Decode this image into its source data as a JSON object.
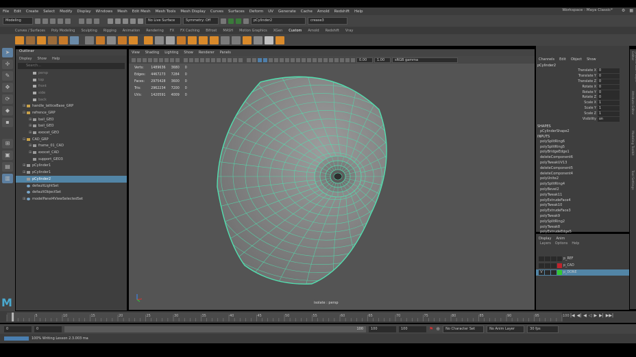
{
  "menubar": [
    "File",
    "Edit",
    "Create",
    "Select",
    "Modify",
    "Display",
    "Windows",
    "Mesh",
    "Edit Mesh",
    "Mesh Tools",
    "Mesh Display",
    "Curves",
    "Surfaces",
    "Deform",
    "UV",
    "Generate",
    "Cache",
    "Arnold",
    "Redshift",
    "Help"
  ],
  "workspace": {
    "label": "Workspace :",
    "value": "Maya Classic*"
  },
  "statusline": {
    "mode": "Modeling",
    "live_surface": "No Live Surface",
    "symmetry": "Symmetry: Off",
    "object_field": "pCylinder2",
    "search_field": "crease3"
  },
  "shelf_tabs": [
    "Curves / Surfaces",
    "Poly Modeling",
    "Sculpting",
    "Rigging",
    "Animation",
    "Rendering",
    "FX",
    "FX Caching",
    "Bifrost",
    "MASH",
    "Motion Graphics",
    "XGen",
    "Custom",
    "Arnold",
    "Redshift",
    "Vray"
  ],
  "shelf_active": "Custom",
  "outliner": {
    "title": "Outliner",
    "menu": [
      "Display",
      "Show",
      "Help"
    ],
    "search_placeholder": "Search...",
    "rows": [
      {
        "label": "persp",
        "indent": 1,
        "type": "cam",
        "dim": true
      },
      {
        "label": "top",
        "indent": 1,
        "type": "cam",
        "dim": true
      },
      {
        "label": "front",
        "indent": 1,
        "type": "cam",
        "dim": true
      },
      {
        "label": "side",
        "indent": 1,
        "type": "cam",
        "dim": true
      },
      {
        "label": "back",
        "indent": 1,
        "type": "cam",
        "dim": true
      },
      {
        "label": "handle_latticeBase_GRP",
        "indent": 0,
        "type": "grp",
        "expand": "+"
      },
      {
        "label": "refrence_GRP",
        "indent": 0,
        "type": "grp",
        "expand": "-"
      },
      {
        "label": "bail_GEO",
        "indent": 1,
        "type": "mesh",
        "expand": "+"
      },
      {
        "label": "bail_GEO",
        "indent": 1,
        "type": "mesh",
        "expand": "+"
      },
      {
        "label": "exocet_GEO",
        "indent": 1,
        "type": "mesh",
        "expand": "+"
      },
      {
        "label": "CAD_GRP",
        "indent": 0,
        "type": "grp",
        "expand": "-"
      },
      {
        "label": "frame_01_CAD",
        "indent": 1,
        "type": "mesh",
        "expand": "+"
      },
      {
        "label": "exocet_CAD",
        "indent": 1,
        "type": "mesh",
        "expand": "+"
      },
      {
        "label": "support_GEO3",
        "indent": 1,
        "type": "mesh"
      },
      {
        "label": "pCylinder1",
        "indent": 0,
        "type": "mesh",
        "expand": "+"
      },
      {
        "label": "pCylinder1",
        "indent": 0,
        "type": "mesh",
        "expand": "+"
      },
      {
        "label": "pCylinder2",
        "indent": 0,
        "type": "mesh",
        "sel": true
      },
      {
        "label": "defaultLightSet",
        "indent": 0,
        "type": "set"
      },
      {
        "label": "defaultObjectSet",
        "indent": 0,
        "type": "set"
      },
      {
        "label": "modelPanel4ViewSelectedSet",
        "indent": 0,
        "type": "set",
        "expand": "+"
      }
    ]
  },
  "viewport": {
    "menu": [
      "View",
      "Shading",
      "Lighting",
      "Show",
      "Renderer",
      "Panels"
    ],
    "exposure": "0.00",
    "gamma": "1.00",
    "colorspace": "sRGB gamma",
    "camera_label": "isolate : persp",
    "hud": [
      {
        "label": "Verts:",
        "a": "1489636",
        "b": "3680",
        "c": "0"
      },
      {
        "label": "Edges:",
        "a": "4467273",
        "b": "7284",
        "c": "0"
      },
      {
        "label": "Faces:",
        "a": "2975428",
        "b": "3600",
        "c": "0"
      },
      {
        "label": "Tris:",
        "a": "2962234",
        "b": "7200",
        "c": "0"
      },
      {
        "label": "UVs:",
        "a": "1420591",
        "b": "4009",
        "c": "0"
      }
    ]
  },
  "channel_box": {
    "menu": [
      "Channels",
      "Edit",
      "Object",
      "Show"
    ],
    "object": "pCylinder2",
    "channels": [
      {
        "label": "Translate X",
        "value": "0"
      },
      {
        "label": "Translate Y",
        "value": "0"
      },
      {
        "label": "Translate Z",
        "value": "0"
      },
      {
        "label": "Rotate X",
        "value": "0"
      },
      {
        "label": "Rotate Y",
        "value": "0"
      },
      {
        "label": "Rotate Z",
        "value": "0"
      },
      {
        "label": "Scale X",
        "value": "1"
      },
      {
        "label": "Scale Y",
        "value": "1"
      },
      {
        "label": "Scale Z",
        "value": "1"
      },
      {
        "label": "Visibility",
        "value": "on"
      }
    ],
    "shapes_header": "SHAPES",
    "shape": "pCylinderShape2",
    "inputs_header": "INPUTS",
    "inputs": [
      "polySplitRing6",
      "polySplitRing5",
      "polyBridgeEdge1",
      "deleteComponent6",
      "polyTweakUV13",
      "deleteComponent5",
      "deleteComponent4",
      "polyUnite2",
      "polySplitRing4",
      "polyBevel2",
      "polyTweak11",
      "polyExtrudeFace4",
      "polyTweak10",
      "polyExtrudeFace3",
      "polyTweak9",
      "polySplitRing2",
      "polyTweak8",
      "polyExtrudeEdge5"
    ]
  },
  "side_tabs": [
    "Channel Box / Layer Editor",
    "Attribute Editor",
    "Modeling Toolkit",
    "Tool Settings"
  ],
  "layer_editor": {
    "tabs": [
      "Display",
      "Anim"
    ],
    "menu": [
      "Layers",
      "Options",
      "Help"
    ],
    "layers": [
      {
        "name": "p_REF",
        "color": "",
        "visible": "",
        "sel": false
      },
      {
        "name": "p_CAD",
        "color": "#c0232c",
        "visible": "",
        "sel": false
      },
      {
        "name": "p_DONE",
        "color": "#32c832",
        "visible": "V",
        "sel": true
      }
    ]
  },
  "timeline": {
    "ticks": [
      "5",
      "10",
      "15",
      "20",
      "25",
      "30",
      "35",
      "40",
      "45",
      "50",
      "55",
      "60",
      "65",
      "70",
      "75",
      "80",
      "85",
      "90",
      "95",
      "100"
    ],
    "current": "1"
  },
  "range": {
    "start": "0",
    "start2": "0",
    "end": "100",
    "end2": "100",
    "end3": "100",
    "character_set": "No Character Set",
    "anim_layer": "No Anim Layer",
    "fps": "30 fps"
  },
  "command_line": {
    "language": "MEL",
    "message": "100% Writing Lesson 2.3.003 ma"
  },
  "colors": {
    "wire": "#52e0b0",
    "mesh": "#8f8f8f",
    "selection": "#5285a6",
    "accent_blue": "#4aa9cf"
  }
}
